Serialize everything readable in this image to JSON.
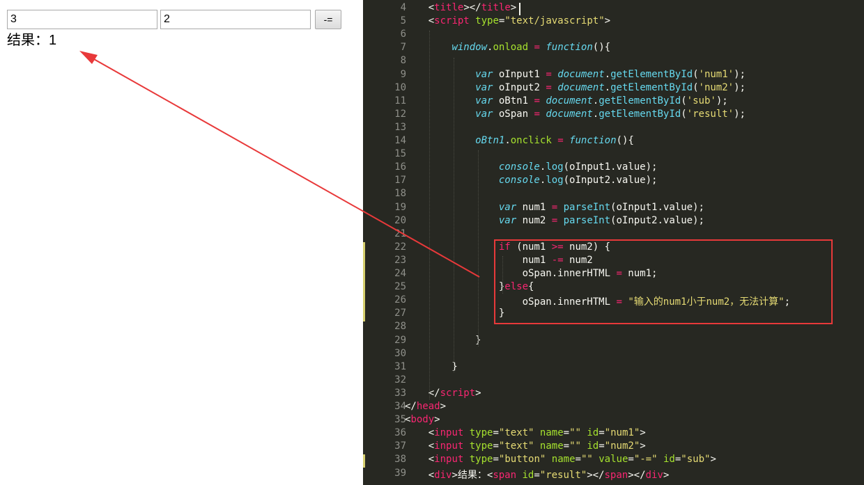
{
  "browser": {
    "input1_value": "3",
    "input2_value": "2",
    "button_label": "-=",
    "result_label": "结果：",
    "result_value": "1"
  },
  "editor": {
    "lines": [
      {
        "n": "4",
        "html": "    &lt;<span class='t'>title</span>&gt;&lt;/<span class='t'>title</span>&gt;"
      },
      {
        "n": "5",
        "html": "    &lt;<span class='t'>script</span> <span class='a'>type</span>=<span class='s'>\"text/javascript\"</span>&gt;"
      },
      {
        "n": "6",
        "html": ""
      },
      {
        "n": "7",
        "html": "        <span class='k'>window</span>.<span class='a'>onload</span> <span class='o'>=</span> <span class='k'>function</span>(){"
      },
      {
        "n": "8",
        "html": ""
      },
      {
        "n": "9",
        "html": "            <span class='k'>var</span> oInput1 <span class='o'>=</span> <span class='k'>document</span>.<span class='f'>getElementById</span>(<span class='s'>'num1'</span>);"
      },
      {
        "n": "10",
        "html": "            <span class='k'>var</span> oInput2 <span class='o'>=</span> <span class='k'>document</span>.<span class='f'>getElementById</span>(<span class='s'>'num2'</span>);"
      },
      {
        "n": "11",
        "html": "            <span class='k'>var</span> oBtn1 <span class='o'>=</span> <span class='k'>document</span>.<span class='f'>getElementById</span>(<span class='s'>'sub'</span>);"
      },
      {
        "n": "12",
        "html": "            <span class='k'>var</span> oSpan <span class='o'>=</span> <span class='k'>document</span>.<span class='f'>getElementById</span>(<span class='s'>'result'</span>);"
      },
      {
        "n": "13",
        "html": ""
      },
      {
        "n": "14",
        "html": "            <span class='k'>oBtn1</span>.<span class='a'>onclick</span> <span class='o'>=</span> <span class='k'>function</span>(){"
      },
      {
        "n": "15",
        "html": ""
      },
      {
        "n": "16",
        "html": "                <span class='k'>console</span>.<span class='f'>log</span>(oInput1.value);"
      },
      {
        "n": "17",
        "html": "                <span class='k'>console</span>.<span class='f'>log</span>(oInput2.value);"
      },
      {
        "n": "18",
        "html": ""
      },
      {
        "n": "19",
        "html": "                <span class='k'>var</span> num1 <span class='o'>=</span> <span class='f'>parseInt</span>(oInput1.value);"
      },
      {
        "n": "20",
        "html": "                <span class='k'>var</span> num2 <span class='o'>=</span> <span class='f'>parseInt</span>(oInput2.value);"
      },
      {
        "n": "21",
        "html": ""
      },
      {
        "n": "22",
        "html": "                <span class='t'>if</span> (num1 <span class='o'>&gt;=</span> num2) {"
      },
      {
        "n": "23",
        "html": "                    num1 <span class='o'>-=</span> num2"
      },
      {
        "n": "24",
        "html": "                    oSpan.innerHTML <span class='o'>=</span> num1;"
      },
      {
        "n": "25",
        "html": "                }<span class='t'>else</span>{"
      },
      {
        "n": "26",
        "html": "                    oSpan.innerHTML <span class='o'>=</span> <span class='s'>\"输入的num1小于num2，无法计算\"</span>;"
      },
      {
        "n": "27",
        "html": "                }"
      },
      {
        "n": "28",
        "html": ""
      },
      {
        "n": "29",
        "html": "            }"
      },
      {
        "n": "30",
        "html": ""
      },
      {
        "n": "31",
        "html": "        }"
      },
      {
        "n": "32",
        "html": ""
      },
      {
        "n": "33",
        "html": "    &lt;/<span class='t'>script</span>&gt;"
      },
      {
        "n": "34",
        "html": "&lt;/<span class='t'>head</span>&gt;"
      },
      {
        "n": "35",
        "html": "&lt;<span class='t'>body</span>&gt;"
      },
      {
        "n": "36",
        "html": "    &lt;<span class='t'>input</span> <span class='a'>type</span>=<span class='s'>\"text\"</span> <span class='a'>name</span>=<span class='s'>\"\"</span> <span class='a'>id</span>=<span class='s'>\"num1\"</span>&gt;"
      },
      {
        "n": "37",
        "html": "    &lt;<span class='t'>input</span> <span class='a'>type</span>=<span class='s'>\"text\"</span> <span class='a'>name</span>=<span class='s'>\"\"</span> <span class='a'>id</span>=<span class='s'>\"num2\"</span>&gt;"
      },
      {
        "n": "38",
        "html": "    &lt;<span class='t'>input</span> <span class='a'>type</span>=<span class='s'>\"button\"</span> <span class='a'>name</span>=<span class='s'>\"\"</span> <span class='a'>value</span>=<span class='s'>\"-=\"</span> <span class='a'>id</span>=<span class='s'>\"sub\"</span>&gt;"
      },
      {
        "n": "39",
        "html": "    &lt;<span class='t'>div</span>&gt;结果：&lt;<span class='t'>span</span> <span class='a'>id</span>=<span class='s'>\"result\"</span>&gt;&lt;/<span class='t'>span</span>&gt;&lt;/<span class='t'>div</span>&gt;"
      }
    ],
    "modified_lines": [
      "22",
      "23",
      "24",
      "25",
      "26",
      "27",
      "38"
    ],
    "colors": {
      "background": "#272822",
      "highlight_box": "#e8393a",
      "arrow": "#e8393a"
    }
  }
}
